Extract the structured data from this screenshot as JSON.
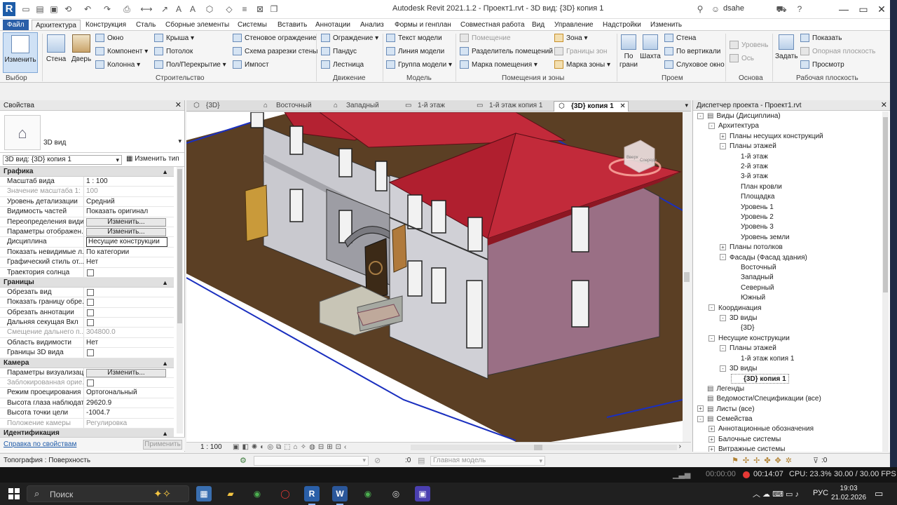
{
  "title": {
    "window_title": "Autodesk Revit 2021.1.2 - Проект1.rvt - 3D вид: {3D} копия 1",
    "user": "dsahe"
  },
  "menu": {
    "items": [
      "Файл",
      "Архитектура",
      "Конструкция",
      "Сталь",
      "Сборные элементы",
      "Системы",
      "Вставить",
      "Аннотации",
      "Анализ",
      "Формы и генплан",
      "Совместная работа",
      "Вид",
      "Управление",
      "Надстройки",
      "Изменить"
    ],
    "active": "Архитектура"
  },
  "ribbon": {
    "modify": "Изменить",
    "wall": "Стена",
    "door": "Дверь",
    "window": "Окно",
    "component": "Компонент",
    "column": "Колонна",
    "roof": "Крыша",
    "ceiling": "Потолок",
    "floor": "Пол/Перекрытие",
    "curtain_system": "Стеновое ограждение",
    "curtain_grid": "Схема разрезки стены",
    "mullion": "Импост",
    "railing": "Ограждение",
    "ramp": "Пандус",
    "stair": "Лестница",
    "model_text": "Текст модели",
    "model_line": "Линия модели",
    "model_group": "Группа модели",
    "room": "Помещение",
    "room_separator": "Разделитель помещений",
    "room_tag": "Марка помещения",
    "area": "Зона",
    "area_boundary": "Границы зон",
    "area_tag": "Марка зоны",
    "by_face": "По грани",
    "shaft": "Шахта",
    "wall_opening": "Стена",
    "vertical": "По вертикали",
    "dormer": "Слуховое окно",
    "level": "Уровень",
    "grid": "Ось",
    "set": "Задать",
    "show": "Показать",
    "ref_plane": "Опорная плоскость",
    "viewer": "Просмотр",
    "groups": {
      "select": "Выбор",
      "build": "Строительство",
      "circulation": "Движение",
      "model": "Модель",
      "room_area": "Помещения и зоны",
      "opening": "Проем",
      "datum": "Основа",
      "work_plane": "Рабочая плоскость"
    }
  },
  "properties": {
    "header": "Свойства",
    "type_name": "3D вид",
    "selector": "3D вид: {3D} копия 1",
    "edit_type": "Изменить тип",
    "sections": [
      {
        "name": "Графика",
        "rows": [
          {
            "k": "Масштаб вида",
            "v": "1 : 100"
          },
          {
            "k": "Значение масштаба    1:",
            "v": "100",
            "dis": true
          },
          {
            "k": "Уровень детализации",
            "v": "Средний"
          },
          {
            "k": "Видимость частей",
            "v": "Показать оригинал"
          },
          {
            "k": "Переопределения видим...",
            "btn": "Изменить..."
          },
          {
            "k": "Параметры отображен...",
            "btn": "Изменить..."
          },
          {
            "k": "Дисциплина",
            "v": "Несущие конструкции",
            "boxed": true
          },
          {
            "k": "Показать невидимые л...",
            "v": "По категории"
          },
          {
            "k": "Графический стиль от...",
            "v": "Нет"
          },
          {
            "k": "Траектория солнца",
            "cb": true
          }
        ]
      },
      {
        "name": "Границы",
        "rows": [
          {
            "k": "Обрезать вид",
            "cb": true
          },
          {
            "k": "Показать границу обре...",
            "cb": true
          },
          {
            "k": "Обрезать аннотации",
            "cb": true
          },
          {
            "k": "Дальняя секущая Вкл",
            "cb": true
          },
          {
            "k": "Смещение дальнего п...",
            "v": "304800.0",
            "dis": true
          },
          {
            "k": "Область видимости",
            "v": "Нет"
          },
          {
            "k": "Границы 3D вида",
            "cb": true
          }
        ]
      },
      {
        "name": "Камера",
        "rows": [
          {
            "k": "Параметры визуализац...",
            "btn": "Изменить..."
          },
          {
            "k": "Заблокированная орие...",
            "cb": true,
            "dis": true
          },
          {
            "k": "Режим проецирования",
            "v": "Ортогональный"
          },
          {
            "k": "Высота глаза наблюдат...",
            "v": "29620.9"
          },
          {
            "k": "Высота точки цели",
            "v": "-1004.7"
          },
          {
            "k": "Положение камеры",
            "v": "Регулировка",
            "dis": true
          }
        ]
      },
      {
        "name": "Идентификация",
        "rows": []
      }
    ],
    "help_link": "Справка по свойствам",
    "apply": "Применить"
  },
  "view_tabs": [
    {
      "label": "{3D}"
    },
    {
      "label": "Восточный"
    },
    {
      "label": "Западный"
    },
    {
      "label": "1-й этаж"
    },
    {
      "label": "1-й этаж копия 1"
    },
    {
      "label": "{3D} копия 1",
      "active": true
    }
  ],
  "view_status": {
    "scale": "1 : 100"
  },
  "viewcube": {
    "face1": "Вверх",
    "face2": "Спереди"
  },
  "browser": {
    "header": "Диспетчер проекта - Проект1.rvt",
    "tree": [
      {
        "label": "Виды (Дисциплина)",
        "depth": 0,
        "t": "-"
      },
      {
        "label": "Архитектура",
        "depth": 1,
        "t": "-"
      },
      {
        "label": "Планы несущих конструкций",
        "depth": 2,
        "t": "+"
      },
      {
        "label": "Планы этажей",
        "depth": 2,
        "t": "-"
      },
      {
        "label": "1-й этаж",
        "depth": 3
      },
      {
        "label": "2-й этаж",
        "depth": 3
      },
      {
        "label": "3-й этаж",
        "depth": 3
      },
      {
        "label": "План кровли",
        "depth": 3
      },
      {
        "label": "Площадка",
        "depth": 3
      },
      {
        "label": "Уровень 1",
        "depth": 3
      },
      {
        "label": "Уровень 2",
        "depth": 3
      },
      {
        "label": "Уровень 3",
        "depth": 3
      },
      {
        "label": "Уровень земли",
        "depth": 3
      },
      {
        "label": "Планы потолков",
        "depth": 2,
        "t": "+"
      },
      {
        "label": "Фасады (Фасад здания)",
        "depth": 2,
        "t": "-"
      },
      {
        "label": "Восточный",
        "depth": 3
      },
      {
        "label": "Западный",
        "depth": 3
      },
      {
        "label": "Северный",
        "depth": 3
      },
      {
        "label": "Южный",
        "depth": 3
      },
      {
        "label": "Координация",
        "depth": 1,
        "t": "-"
      },
      {
        "label": "3D виды",
        "depth": 2,
        "t": "-"
      },
      {
        "label": "{3D}",
        "depth": 3
      },
      {
        "label": "Несущие конструкции",
        "depth": 1,
        "t": "-"
      },
      {
        "label": "Планы этажей",
        "depth": 2,
        "t": "-"
      },
      {
        "label": "1-й этаж копия 1",
        "depth": 3
      },
      {
        "label": "3D виды",
        "depth": 2,
        "t": "-"
      },
      {
        "label": "{3D} копия 1",
        "depth": 3,
        "sel": true
      },
      {
        "label": "Легенды",
        "depth": 0
      },
      {
        "label": "Ведомости/Спецификации (все)",
        "depth": 0
      },
      {
        "label": "Листы (все)",
        "depth": 0,
        "t": "+"
      },
      {
        "label": "Семейства",
        "depth": 0,
        "t": "-"
      },
      {
        "label": "Аннотационные обозначения",
        "depth": 1,
        "t": "+"
      },
      {
        "label": "Балочные системы",
        "depth": 1,
        "t": "+"
      },
      {
        "label": "Витражные системы",
        "depth": 1,
        "t": "+"
      }
    ]
  },
  "status": {
    "text": "Топография : Поверхность",
    "filter": ":0",
    "main_model": "Главная модель",
    "filter_count": ":0"
  },
  "recorder": {
    "time1": "00:00:00",
    "time2": "00:14:07",
    "cpu": "CPU: 23.3%",
    "fps": "30.00 / 30.00 FPS"
  },
  "taskbar": {
    "search": "Поиск",
    "lang": "РУС",
    "time": "19:03",
    "date": "21.02.2026"
  }
}
